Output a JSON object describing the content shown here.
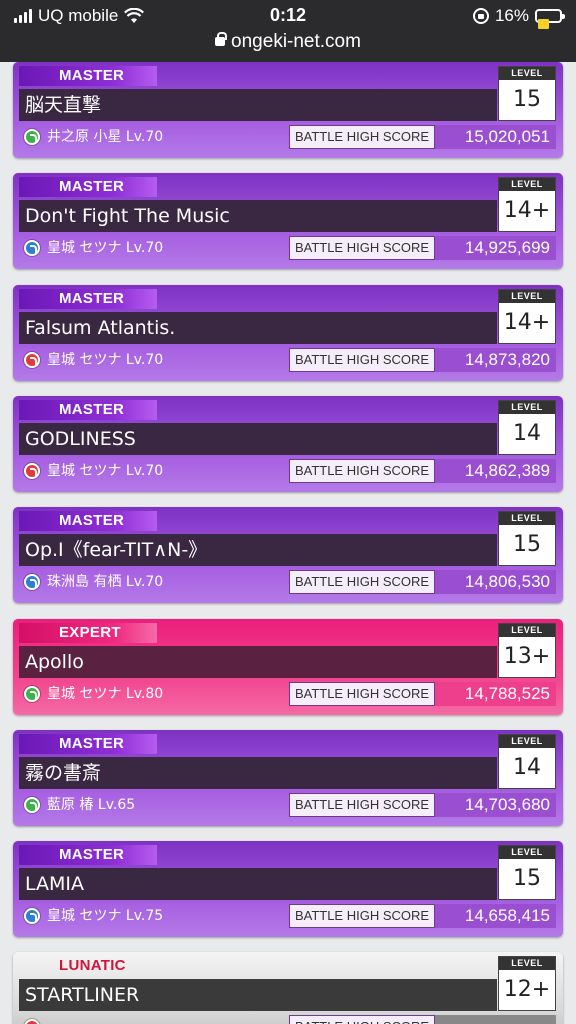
{
  "status_bar": {
    "carrier": "UQ mobile",
    "time": "0:12",
    "battery_percent": "16%",
    "url": "ongeki-net.com"
  },
  "labels": {
    "level": "LEVEL",
    "battle_high_score": "BATTLE HIGH SCORE"
  },
  "colors": {
    "master": "#8a3fd0",
    "expert": "#ec2a80",
    "lunatic": "#d0143a"
  },
  "scores": [
    {
      "difficulty": "MASTER",
      "title": "脳天直撃",
      "level": "15",
      "character": "井之原 小星 Lv.70",
      "icon": "green-character-icon",
      "score": "15,020,051"
    },
    {
      "difficulty": "MASTER",
      "title": "Don't Fight The Music",
      "level": "14+",
      "character": "皇城 セツナ Lv.70",
      "icon": "blue-character-icon",
      "score": "14,925,699"
    },
    {
      "difficulty": "MASTER",
      "title": "Falsum Atlantis.",
      "level": "14+",
      "character": "皇城 セツナ Lv.70",
      "icon": "red-character-icon",
      "score": "14,873,820"
    },
    {
      "difficulty": "MASTER",
      "title": "GODLINESS",
      "level": "14",
      "character": "皇城 セツナ Lv.70",
      "icon": "red-character-icon",
      "score": "14,862,389"
    },
    {
      "difficulty": "MASTER",
      "title": "Op.I《fear-TIT∧N-》",
      "level": "15",
      "character": "珠洲島 有栖 Lv.70",
      "icon": "blue-character-icon",
      "score": "14,806,530"
    },
    {
      "difficulty": "EXPERT",
      "title": "Apollo",
      "level": "13+",
      "character": "皇城 セツナ Lv.80",
      "icon": "green-character-icon",
      "score": "14,788,525"
    },
    {
      "difficulty": "MASTER",
      "title": "霧の書斎",
      "level": "14",
      "character": "藍原 椿 Lv.65",
      "icon": "green-character-icon",
      "score": "14,703,680"
    },
    {
      "difficulty": "MASTER",
      "title": "LAMIA",
      "level": "15",
      "character": "皇城 セツナ Lv.75",
      "icon": "blue-character-icon",
      "score": "14,658,415"
    },
    {
      "difficulty": "LUNATIC",
      "title": "STARTLINER",
      "level": "12+",
      "character": "",
      "icon": "red-character-icon",
      "score": ""
    }
  ]
}
